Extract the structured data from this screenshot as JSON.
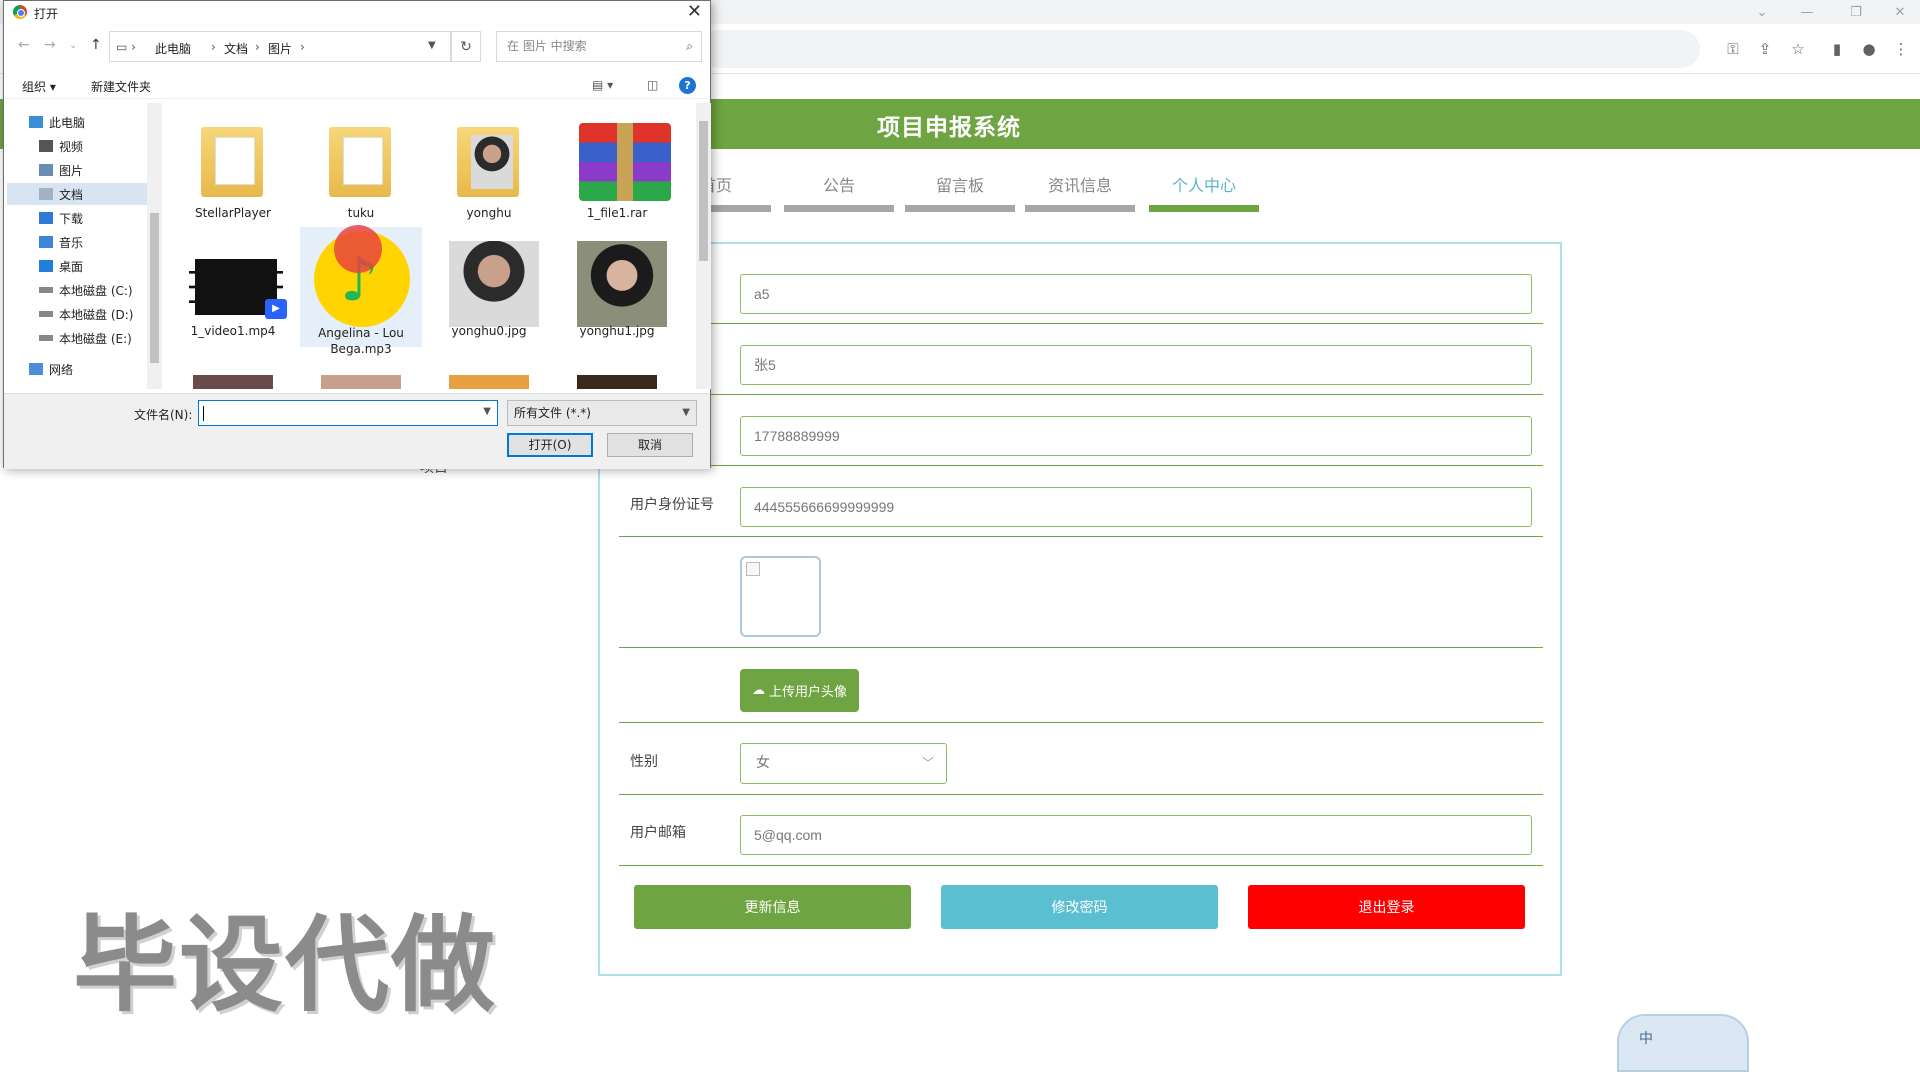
{
  "site": {
    "title": "项目申报系统",
    "nav": [
      {
        "label": "首页"
      },
      {
        "label": "公告"
      },
      {
        "label": "留言板"
      },
      {
        "label": "资讯信息"
      },
      {
        "label": "个人中心"
      }
    ]
  },
  "profile": {
    "username": "a5",
    "realname": "张5",
    "phone": "17788889999",
    "id_label": "用户身份证号",
    "id_number": "444555666699999999",
    "upload_label": "上传用户头像",
    "gender_label": "性别",
    "gender_value": "女",
    "email_label": "用户邮箱",
    "email": "5@qq.com",
    "btn_update": "更新信息",
    "btn_password": "修改密码",
    "btn_logout": "退出登录",
    "colors": {
      "primary": "#6ea441",
      "info": "#5bbfd2",
      "danger": "#ff0000"
    }
  },
  "background": {
    "watermark": "毕设代做",
    "partial_label": "项目"
  },
  "ime": {
    "mode": "中"
  },
  "dialog": {
    "title": "打开",
    "breadcrumb": [
      "此电脑",
      "文档",
      "图片"
    ],
    "search_placeholder": "在 图片 中搜索",
    "organize": "组织 ▾",
    "new_folder": "新建文件夹",
    "tree": [
      {
        "label": "此电脑",
        "icon": "computer-icon"
      },
      {
        "label": "视频",
        "icon": "video-folder-icon"
      },
      {
        "label": "图片",
        "icon": "picture-folder-icon"
      },
      {
        "label": "文档",
        "icon": "document-folder-icon"
      },
      {
        "label": "下载",
        "icon": "download-folder-icon"
      },
      {
        "label": "音乐",
        "icon": "music-folder-icon"
      },
      {
        "label": "桌面",
        "icon": "desktop-folder-icon"
      },
      {
        "label": "本地磁盘 (C:)",
        "icon": "drive-icon"
      },
      {
        "label": "本地磁盘 (D:)",
        "icon": "drive-icon"
      },
      {
        "label": "本地磁盘 (E:)",
        "icon": "drive-icon"
      },
      {
        "label": "网络",
        "icon": "network-icon"
      }
    ],
    "files": [
      {
        "name": "StellarPlayer",
        "type": "folder"
      },
      {
        "name": "tuku",
        "type": "folder"
      },
      {
        "name": "yonghu",
        "type": "folder"
      },
      {
        "name": "1_file1.rar",
        "type": "archive"
      },
      {
        "name": "1_video1.mp4",
        "type": "video"
      },
      {
        "name": "Angelina - Lou Bega.mp3",
        "type": "audio"
      },
      {
        "name": "yonghu0.jpg",
        "type": "image"
      },
      {
        "name": "yonghu1.jpg",
        "type": "image"
      }
    ],
    "filename_label": "文件名(N):",
    "filename_value": "",
    "filter": "所有文件 (*.*)",
    "open_button": "打开(O)",
    "cancel_button": "取消"
  }
}
